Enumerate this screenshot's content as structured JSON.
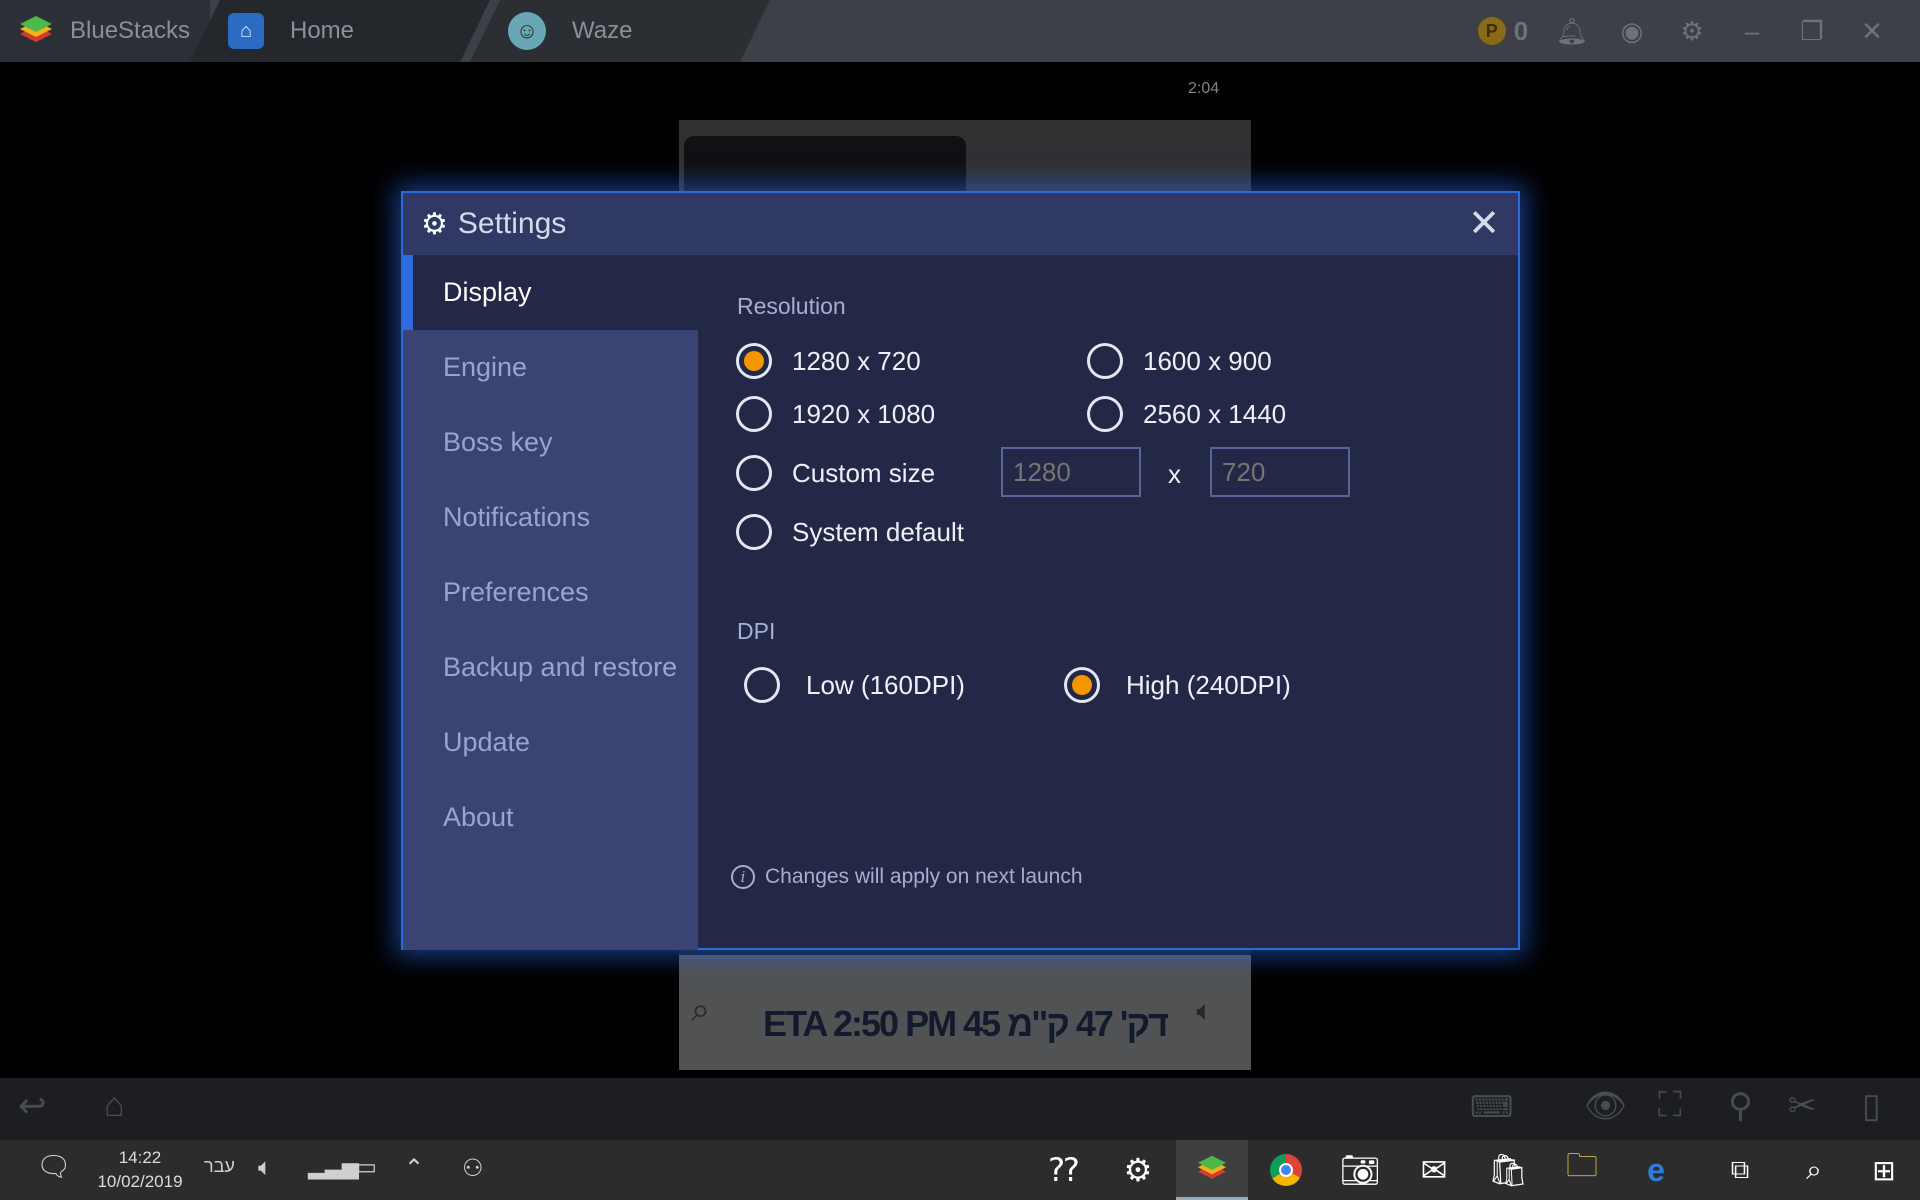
{
  "titlebar": {
    "brand": "BlueStacks",
    "tabs": [
      {
        "label": "Home",
        "icon": "home-icon"
      },
      {
        "label": "Waze",
        "icon": "waze-icon"
      }
    ],
    "coins": "0"
  },
  "waze": {
    "status_time": "2:04",
    "eta_text": "ETA 2:50 PM  45 דק'  47 ק\"מ"
  },
  "settings": {
    "title": "Settings",
    "sidebar": [
      {
        "label": "Display",
        "active": true
      },
      {
        "label": "Engine",
        "active": false
      },
      {
        "label": "Boss key",
        "active": false
      },
      {
        "label": "Notifications",
        "active": false
      },
      {
        "label": "Preferences",
        "active": false
      },
      {
        "label": "Backup and restore",
        "active": false
      },
      {
        "label": "Update",
        "active": false
      },
      {
        "label": "About",
        "active": false
      }
    ],
    "resolution": {
      "label": "Resolution",
      "options": [
        {
          "label": "1280 x 720",
          "selected": true
        },
        {
          "label": "1600 x 900",
          "selected": false
        },
        {
          "label": "1920 x 1080",
          "selected": false
        },
        {
          "label": "2560 x 1440",
          "selected": false
        },
        {
          "label": "Custom size",
          "selected": false
        },
        {
          "label": "System default",
          "selected": false
        }
      ],
      "custom_width_placeholder": "1280",
      "custom_height_placeholder": "720",
      "custom_separator": "x"
    },
    "dpi": {
      "label": "DPI",
      "options": [
        {
          "label": "Low (160DPI)",
          "selected": false
        },
        {
          "label": "High (240DPI)",
          "selected": true
        }
      ]
    },
    "footnote": "Changes will apply on next launch"
  },
  "taskbar": {
    "time": "14:22",
    "date": "10/02/2019",
    "language": "עבר"
  },
  "colors": {
    "accent_orange": "#f39600",
    "dialog_bg": "#222845",
    "sidebar_bg": "#3a4371",
    "highlight_blue": "#2d6bde"
  }
}
